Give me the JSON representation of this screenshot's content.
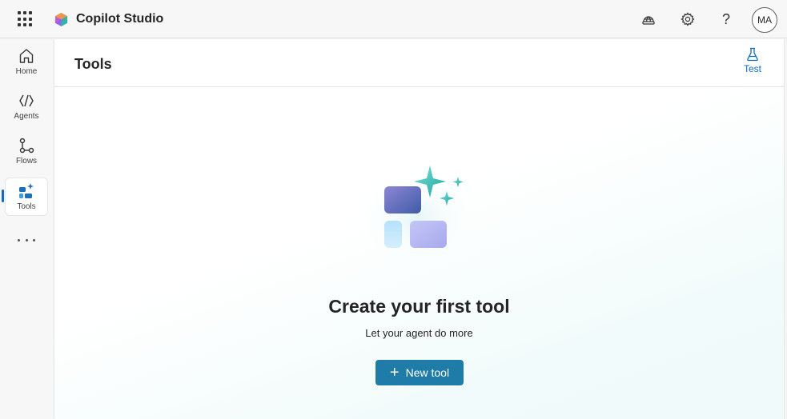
{
  "app": {
    "title": "Copilot Studio",
    "user_initials": "MA"
  },
  "topbar": {
    "icons": [
      "app-launcher-icon",
      "environment-globe-icon",
      "settings-gear-icon",
      "help-question-icon"
    ],
    "help_glyph": "?"
  },
  "rail": {
    "items": [
      {
        "label": "Home",
        "icon": "home-icon"
      },
      {
        "label": "Agents",
        "icon": "agents-icon"
      },
      {
        "label": "Flows",
        "icon": "flows-icon"
      },
      {
        "label": "Tools",
        "icon": "tools-icon",
        "active": true
      }
    ],
    "more_icon": "more-horizontal-icon"
  },
  "page": {
    "title": "Tools",
    "test_label": "Test"
  },
  "empty_state": {
    "title": "Create your first tool",
    "subtitle": "Let your agent do more",
    "button_label": "New tool"
  },
  "colors": {
    "accent": "#0f6cbd",
    "primary_button": "#1f7ca8"
  }
}
